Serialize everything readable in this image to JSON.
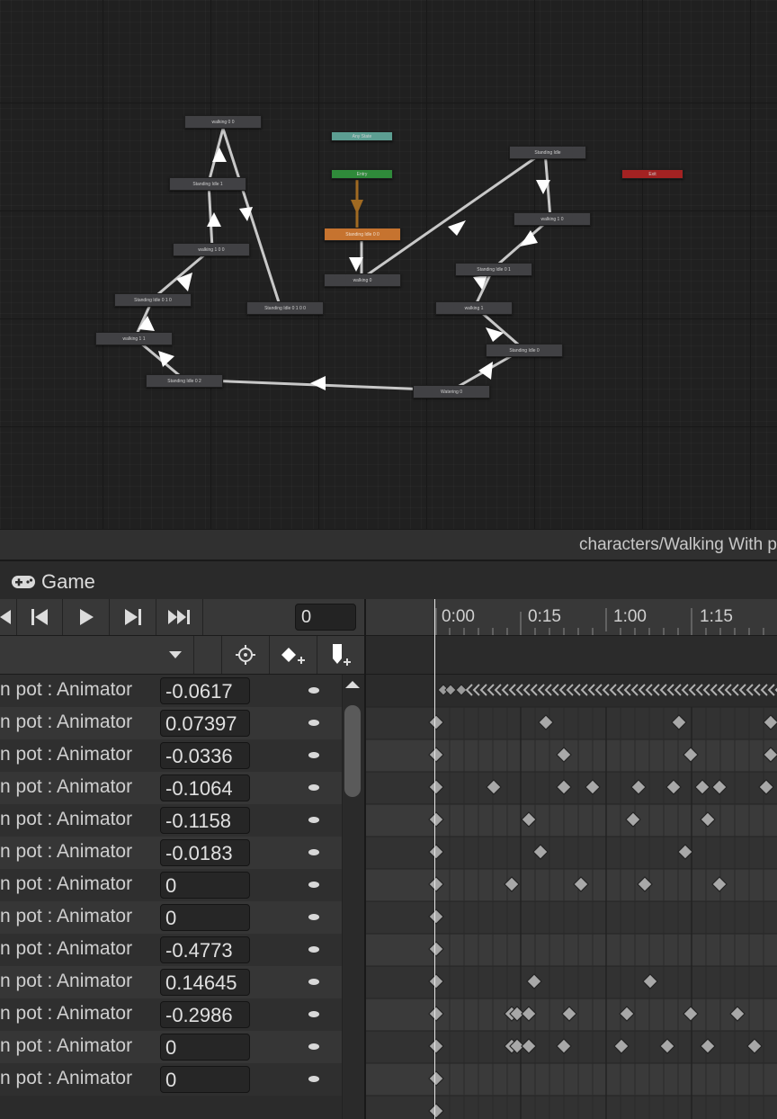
{
  "graph": {
    "nodes": [
      {
        "id": "walking00",
        "label": "walking 0 0"
      },
      {
        "id": "standingidle1",
        "label": "Standing Idle 1"
      },
      {
        "id": "walking100",
        "label": "walking 1 0 0"
      },
      {
        "id": "standingidle010",
        "label": "Standing Idle 0 1 0"
      },
      {
        "id": "walking11",
        "label": "walking 1 1"
      },
      {
        "id": "standingidle02",
        "label": "Standing Idle 0 2"
      },
      {
        "id": "standingidle0100",
        "label": "Standing Idle 0 1 0 0"
      },
      {
        "id": "anystate",
        "label": "Any State"
      },
      {
        "id": "entry",
        "label": "Entry"
      },
      {
        "id": "standingidle00",
        "label": "Standing Idle 0 0"
      },
      {
        "id": "walking0",
        "label": "walking 0"
      },
      {
        "id": "standingidle",
        "label": "Standing Idle"
      },
      {
        "id": "exit",
        "label": "Exit"
      },
      {
        "id": "walking10",
        "label": "walking 1 0"
      },
      {
        "id": "standingidle01",
        "label": "Standing Idle 0 1"
      },
      {
        "id": "walking1",
        "label": "walking 1"
      },
      {
        "id": "standingidle0",
        "label": "Standing Idle 0"
      },
      {
        "id": "watering0",
        "label": "Watering 0"
      }
    ]
  },
  "statusbar": {
    "path": "characters/Walking With p"
  },
  "tab": {
    "title": "Game",
    "icon": "gamepad-icon"
  },
  "controls": {
    "frame": "0"
  },
  "timeline": {
    "ticks": [
      "0:00",
      "0:15",
      "1:00",
      "1:15"
    ]
  },
  "properties": [
    {
      "label": "n pot : Animator",
      "value": "-0.0617"
    },
    {
      "label": "n pot : Animator",
      "value": "0.07397"
    },
    {
      "label": "n pot : Animator",
      "value": "-0.0336"
    },
    {
      "label": "n pot : Animator",
      "value": "-0.1064"
    },
    {
      "label": "n pot : Animator",
      "value": "-0.1158"
    },
    {
      "label": "n pot : Animator",
      "value": "-0.0183"
    },
    {
      "label": "n pot : Animator",
      "value": "0"
    },
    {
      "label": "n pot : Animator",
      "value": "0"
    },
    {
      "label": "n pot : Animator",
      "value": "-0.4773"
    },
    {
      "label": "n pot : Animator",
      "value": "0.14645"
    },
    {
      "label": "n pot : Animator",
      "value": "-0.2986"
    },
    {
      "label": "n pot : Animator",
      "value": "0"
    },
    {
      "label": "n pot : Animator",
      "value": "0"
    }
  ]
}
